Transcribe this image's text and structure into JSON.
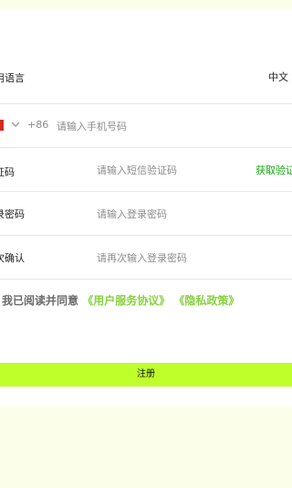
{
  "form": {
    "language": {
      "label": "用语言",
      "value": "中文"
    },
    "phone": {
      "dial_code": "+86",
      "placeholder": "请输入手机号码"
    },
    "sms_code": {
      "label": "证码",
      "placeholder": "请输入短信验证码",
      "get_code_label": "获取验证"
    },
    "password": {
      "label": "录密码",
      "placeholder": "请输入登录密码"
    },
    "confirm_password": {
      "label": "次确认",
      "placeholder": "请再次输入登录密码"
    },
    "agreement": {
      "text": "我已阅读并同意",
      "user_agreement_link": "《用户服务协议》",
      "privacy_policy_link": "《隐私政策》"
    },
    "register_button_label": "注册"
  },
  "colors": {
    "accent": "#BFFF2A",
    "link": "#86D13C",
    "get_code": "#10A810",
    "background": "#FBFFEA",
    "flag": "#D52B1E"
  },
  "icons": {
    "flag": "china-flag-icon",
    "dropdown": "chevron-down-icon"
  }
}
